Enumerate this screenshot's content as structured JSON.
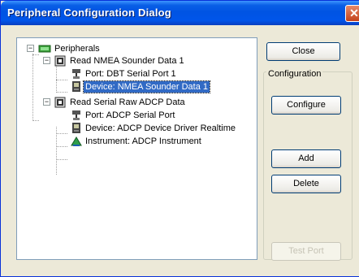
{
  "window": {
    "title": "Peripheral Configuration Dialog",
    "close_glyph": "✕"
  },
  "tree": {
    "root": {
      "label": "Peripherals",
      "icon": "peripherals-icon",
      "expander": "−"
    },
    "groups": [
      {
        "label": "Read NMEA Sounder Data 1",
        "icon": "task-icon",
        "expander": "−",
        "children": [
          {
            "label": "Port: DBT Serial Port 1",
            "icon": "serial-port-icon"
          },
          {
            "label": "Device: NMEA Sounder Data 1",
            "icon": "device-icon",
            "selected": true
          }
        ]
      },
      {
        "label": "Read Serial Raw ADCP Data",
        "icon": "task-icon",
        "expander": "−",
        "children": [
          {
            "label": "Port: ADCP Serial Port",
            "icon": "serial-port-icon"
          },
          {
            "label": "Device: ADCP Device Driver Realtime",
            "icon": "device-icon"
          },
          {
            "label": "Instrument: ADCP Instrument",
            "icon": "instrument-icon"
          }
        ]
      }
    ]
  },
  "buttons": {
    "close": "Close",
    "configure": "Configure",
    "add": "Add",
    "delete": "Delete",
    "test_port": "Test Port"
  },
  "configuration_group_label": "Configuration"
}
